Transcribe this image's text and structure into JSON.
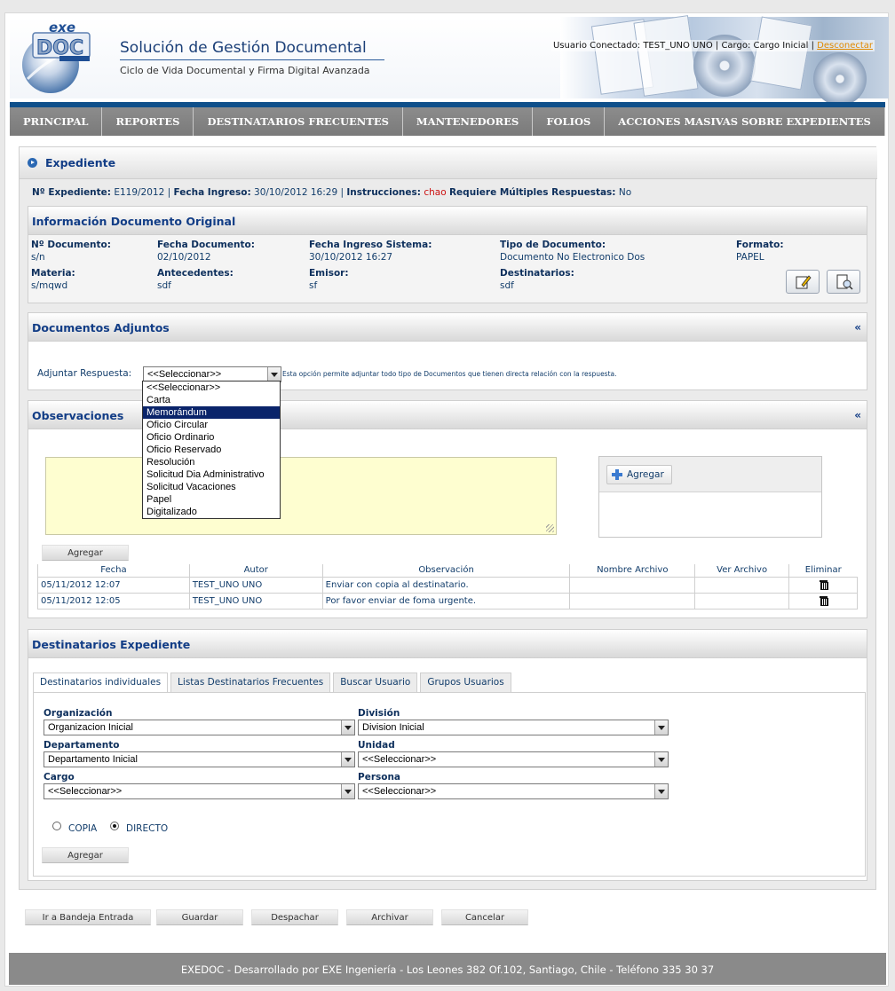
{
  "header": {
    "logo_text": "exe DOC",
    "logo_tagline": "FIRMA DIGITAL",
    "title": "Solución de Gestión Documental",
    "subtitle": "Ciclo de Vida Documental y Firma Digital Avanzada",
    "user_prefix": "Usuario Conectado: TEST_UNO UNO | Cargo: Cargo Inicial | ",
    "logout_label": "Desconectar"
  },
  "nav": {
    "items": [
      "PRINCIPAL",
      "REPORTES",
      "DESTINATARIOS FRECUENTES",
      "MANTENEDORES",
      "FOLIOS",
      "ACCIONES MASIVAS SOBRE EXPEDIENTES"
    ]
  },
  "expediente": {
    "title": "Expediente",
    "num_label": "Nº Expediente:",
    "num_value": "E119/2012",
    "fecha_label": "Fecha Ingreso:",
    "fecha_value": "30/10/2012 16:29",
    "instr_label": "Instrucciones:",
    "instr_value": "chao",
    "multi_label": "Requiere Múltiples Respuestas:",
    "multi_value": "No"
  },
  "doc_original": {
    "title": "Información Documento Original",
    "fields": [
      {
        "label": "Nº Documento:",
        "value": "s/n"
      },
      {
        "label": "Fecha Documento:",
        "value": "02/10/2012"
      },
      {
        "label": "Fecha Ingreso Sistema:",
        "value": "30/10/2012 16:27"
      },
      {
        "label": "Tipo de Documento:",
        "value": "Documento No Electronico Dos"
      },
      {
        "label": "Formato:",
        "value": "PAPEL"
      },
      {
        "label": "Materia:",
        "value": "s/mqwd"
      },
      {
        "label": "Antecedentes:",
        "value": "sdf"
      },
      {
        "label": "Emisor:",
        "value": "sf"
      },
      {
        "label": "Destinatarios:",
        "value": "sdf"
      }
    ]
  },
  "adjuntos": {
    "title": "Documentos Adjuntos",
    "collapse": "«",
    "label": "Adjuntar Respuesta:",
    "selected": "<<Seleccionar>>",
    "help": "Esta opción permite adjuntar todo tipo de Documentos que tienen directa relación con la respuesta.",
    "options": [
      "<<Seleccionar>>",
      "Carta",
      "Memorándum",
      "Oficio Circular",
      "Oficio Ordinario",
      "Oficio Reservado",
      "Resolución",
      "Solicitud Dia Administrativo",
      "Solicitud Vacaciones",
      "Papel",
      "Digitalizado"
    ],
    "highlighted": "Memorándum"
  },
  "observaciones": {
    "title": "Observaciones",
    "collapse": "«",
    "upload_button": "Agregar",
    "add_button": "Agregar",
    "columns": [
      "Fecha",
      "Autor",
      "Observación",
      "Nombre Archivo",
      "Ver Archivo",
      "Eliminar"
    ],
    "rows": [
      {
        "fecha": "05/11/2012 12:07",
        "autor": "TEST_UNO UNO",
        "obs": "Enviar con copia al destinatario.",
        "archivo": "",
        "ver": ""
      },
      {
        "fecha": "05/11/2012 12:05",
        "autor": "TEST_UNO UNO",
        "obs": "Por favor enviar de foma urgente.",
        "archivo": "",
        "ver": ""
      }
    ]
  },
  "destinatarios": {
    "title": "Destinatarios Expediente",
    "tabs": [
      "Destinatarios individuales",
      "Listas Destinatarios Frecuentes",
      "Buscar Usuario",
      "Grupos Usuarios"
    ],
    "organizacion_label": "Organización",
    "organizacion_value": "Organizacion Inicial",
    "division_label": "División",
    "division_value": "Division Inicial",
    "departamento_label": "Departamento",
    "departamento_value": "Departamento Inicial",
    "unidad_label": "Unidad",
    "unidad_value": "<<Seleccionar>>",
    "cargo_label": "Cargo",
    "cargo_value": "<<Seleccionar>>",
    "persona_label": "Persona",
    "persona_value": "<<Seleccionar>>",
    "copia_label": "COPIA",
    "directo_label": "DIRECTO",
    "add_button": "Agregar"
  },
  "actions": {
    "bandeja": "Ir a Bandeja Entrada",
    "guardar": "Guardar",
    "despachar": "Despachar",
    "archivar": "Archivar",
    "cancelar": "Cancelar"
  },
  "footer": {
    "text": "EXEDOC - Desarrollado por EXE Ingeniería - Los Leones 382 Of.102, Santiago, Chile - Teléfono 335 30 37"
  }
}
